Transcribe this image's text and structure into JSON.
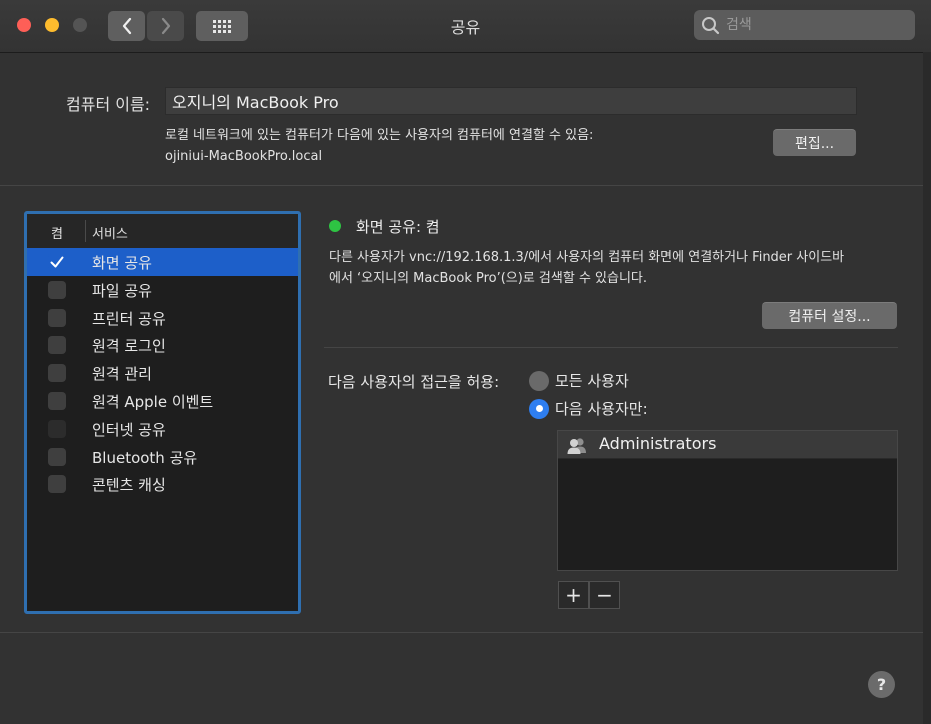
{
  "window": {
    "title": "공유"
  },
  "search": {
    "placeholder": "검색"
  },
  "computer_name": {
    "label": "컴퓨터 이름:",
    "value": "오지니의 MacBook Pro",
    "local_desc_line1": "로컬 네트워크에 있는 컴퓨터가 다음에 있는 사용자의 컴퓨터에 연결할 수 있음:",
    "local_desc_line2": "ojiniui-MacBookPro.local",
    "edit_button": "편집..."
  },
  "services": {
    "col_on": "켬",
    "col_service": "서비스",
    "items": [
      {
        "label": "화면 공유",
        "checked": true,
        "selected": true
      },
      {
        "label": "파일 공유",
        "checked": false,
        "selected": false
      },
      {
        "label": "프린터 공유",
        "checked": false,
        "selected": false
      },
      {
        "label": "원격 로그인",
        "checked": false,
        "selected": false
      },
      {
        "label": "원격 관리",
        "checked": false,
        "selected": false
      },
      {
        "label": "원격 Apple 이벤트",
        "checked": false,
        "selected": false
      },
      {
        "label": "인터넷 공유",
        "checked": false,
        "selected": false
      },
      {
        "label": "Bluetooth 공유",
        "checked": false,
        "selected": false
      },
      {
        "label": "콘텐츠 캐싱",
        "checked": false,
        "selected": false
      }
    ]
  },
  "detail": {
    "status": "화면 공유: 켬",
    "status_color": "#2ec443",
    "desc_line1": "다른 사용자가 vnc://192.168.1.3/에서 사용자의 컴퓨터 화면에 연결하거나 Finder 사이드바",
    "desc_line2": "에서 ‘오지니의 MacBook Pro’(으)로 검색할 수 있습니다.",
    "settings_button": "컴퓨터 설정...",
    "access_label": "다음 사용자의 접근을 허용:",
    "radio_all": "모든 사용자",
    "radio_only": "다음 사용자만:",
    "users": [
      "Administrators"
    ],
    "add_symbol": "+",
    "remove_symbol": "−"
  },
  "help": {
    "symbol": "?"
  },
  "colors": {
    "accent": "#1d5fc9",
    "focus_ring": "#2f6fb0"
  }
}
